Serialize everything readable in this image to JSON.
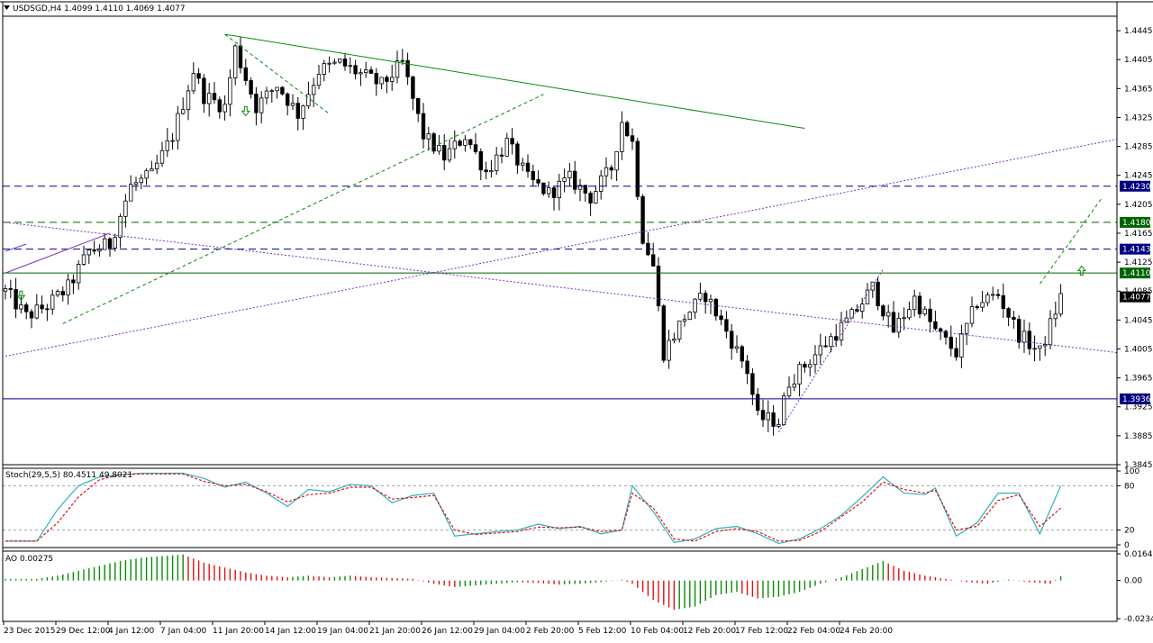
{
  "header": {
    "symbol_line": "USDSGD,H4  1.4099 1.4110 1.4069 1.4077",
    "stoch_label": "Stoch(29,5,5) 80.4511 49.8021",
    "ao_label": "AO 0.00275"
  },
  "colors": {
    "bull_bar": "#000000",
    "bear_bar": "#000000",
    "trend_green": "#0a8a0a",
    "level_blue": "#00008b",
    "level_green": "#006400",
    "channel_purple": "#7b2fbe",
    "stoch_main": "#2fb0c0",
    "stoch_signal": "#e01010",
    "ao_up": "#0a8a0a",
    "ao_down": "#e01010",
    "tag_blue": "#000080",
    "tag_green": "#006400",
    "tag_black": "#000000"
  },
  "chart_data": [
    {
      "type": "candlestick",
      "symbol": "USDSGD",
      "timeframe": "H4",
      "ohlc_current": {
        "open": 1.4099,
        "high": 1.411,
        "low": 1.4069,
        "close": 1.4077
      },
      "ylim": [
        1.3845,
        1.4465
      ],
      "y_ticks": [
        "1.4445",
        "1.4405",
        "1.4365",
        "1.4325",
        "1.4285",
        "1.4245",
        "1.4205",
        "1.4165",
        "1.4125",
        "1.4085",
        "1.4045",
        "1.4005",
        "1.3965",
        "1.3925",
        "1.3885",
        "1.3845"
      ],
      "x_ticks": [
        "23 Dec 2015",
        "29 Dec 12:00",
        "4 Jan 12:00",
        "7 Jan 04:00",
        "11 Jan 20:00",
        "14 Jan 12:00",
        "19 Jan 04:00",
        "21 Jan 20:00",
        "26 Jan 12:00",
        "29 Jan 04:00",
        "2 Feb 20:00",
        "5 Feb 12:00",
        "10 Feb 04:00",
        "12 Feb 20:00",
        "17 Feb 12:00",
        "22 Feb 04:00",
        "24 Feb 20:00"
      ],
      "price_path": [
        [
          0,
          1.4085
        ],
        [
          4,
          1.405
        ],
        [
          8,
          1.4065
        ],
        [
          12,
          1.409
        ],
        [
          16,
          1.414
        ],
        [
          20,
          1.415
        ],
        [
          24,
          1.423
        ],
        [
          28,
          1.4245
        ],
        [
          32,
          1.43
        ],
        [
          36,
          1.439
        ],
        [
          38,
          1.4355
        ],
        [
          42,
          1.434
        ],
        [
          44,
          1.442
        ],
        [
          48,
          1.434
        ],
        [
          52,
          1.437
        ],
        [
          56,
          1.433
        ],
        [
          60,
          1.439
        ],
        [
          64,
          1.44
        ],
        [
          68,
          1.4385
        ],
        [
          72,
          1.437
        ],
        [
          76,
          1.44
        ],
        [
          80,
          1.43
        ],
        [
          84,
          1.427
        ],
        [
          88,
          1.43
        ],
        [
          92,
          1.425
        ],
        [
          96,
          1.429
        ],
        [
          100,
          1.424
        ],
        [
          104,
          1.422
        ],
        [
          108,
          1.424
        ],
        [
          112,
          1.4215
        ],
        [
          116,
          1.4255
        ],
        [
          118,
          1.432
        ],
        [
          120,
          1.429
        ],
        [
          122,
          1.416
        ],
        [
          124,
          1.412
        ],
        [
          126,
          1.4
        ],
        [
          130,
          1.405
        ],
        [
          134,
          1.408
        ],
        [
          138,
          1.403
        ],
        [
          142,
          1.3975
        ],
        [
          144,
          1.391
        ],
        [
          148,
          1.3905
        ],
        [
          150,
          1.396
        ],
        [
          154,
          1.399
        ],
        [
          158,
          1.402
        ],
        [
          162,
          1.405
        ],
        [
          166,
          1.409
        ],
        [
          170,
          1.403
        ],
        [
          174,
          1.4075
        ],
        [
          178,
          1.403
        ],
        [
          182,
          1.4
        ],
        [
          186,
          1.407
        ],
        [
          190,
          1.408
        ],
        [
          194,
          1.4025
        ],
        [
          198,
          1.4
        ],
        [
          202,
          1.4077
        ]
      ],
      "horizontal_levels": [
        {
          "value": 1.423,
          "label": "1.4230",
          "style": "dashed",
          "color": "level_blue"
        },
        {
          "value": 1.418,
          "label": "1.4180",
          "style": "dashed",
          "color": "level_green"
        },
        {
          "value": 1.4143,
          "label": "1.4143",
          "style": "dashed",
          "color": "level_blue"
        },
        {
          "value": 1.411,
          "label": "1.4110",
          "style": "solid",
          "color": "level_green"
        },
        {
          "value": 1.3936,
          "label": "1.3936",
          "style": "solid",
          "color": "level_blue"
        }
      ],
      "current_price_label": "1.4077",
      "trendlines": [
        {
          "from": [
            42,
            1.444
          ],
          "to": [
            153,
            1.431
          ],
          "style": "solid",
          "color": "trend_green"
        },
        {
          "from": [
            42,
            1.444
          ],
          "to": [
            62,
            1.433
          ],
          "style": "dashed",
          "color": "trend_green"
        },
        {
          "from": [
            11,
            1.404
          ],
          "to": [
            103,
            1.4357
          ],
          "style": "dashed",
          "color": "trend_green"
        },
        {
          "from": [
            198,
            1.4095
          ],
          "to": [
            210,
            1.4215
          ],
          "style": "dashed",
          "color": "trend_green"
        },
        {
          "from": [
            0,
            1.3995
          ],
          "to": [
            240,
            1.4295
          ],
          "style": "dotted",
          "color": "channel_purple"
        },
        {
          "from": [
            0,
            1.418
          ],
          "to": [
            240,
            1.4
          ],
          "style": "dotted",
          "color": "channel_purple"
        },
        {
          "from": [
            148,
            1.389
          ],
          "to": [
            168,
            1.4115
          ],
          "style": "dotted",
          "color": "channel_purple"
        },
        {
          "from": [
            0,
            1.411
          ],
          "to": [
            20,
            1.4165
          ],
          "style": "solid",
          "color": "channel_purple"
        },
        {
          "from": [
            0,
            1.414
          ],
          "to": [
            4,
            1.415
          ],
          "style": "solid",
          "color": "channel_purple"
        }
      ],
      "arrows": [
        {
          "x": 3,
          "y": 1.408,
          "direction": "down"
        },
        {
          "x": 46,
          "y": 1.4335,
          "direction": "down"
        },
        {
          "x": 206,
          "y": 1.4112,
          "direction": "up"
        }
      ]
    },
    {
      "type": "line",
      "indicator": "Stochastic",
      "params": "29,5,5",
      "main_value": 80.4511,
      "signal_value": 49.8021,
      "ylim": [
        0,
        100
      ],
      "y_ticks": [
        "100",
        "80",
        "20",
        "0"
      ],
      "levels": [
        80,
        20
      ],
      "series": [
        {
          "role": "main",
          "values": [
            [
              0,
              5
            ],
            [
              6,
              5
            ],
            [
              10,
              48
            ],
            [
              14,
              80
            ],
            [
              18,
              92
            ],
            [
              22,
              95
            ],
            [
              26,
              97
            ],
            [
              30,
              97
            ],
            [
              34,
              97
            ],
            [
              38,
              90
            ],
            [
              42,
              78
            ],
            [
              46,
              85
            ],
            [
              50,
              70
            ],
            [
              54,
              52
            ],
            [
              58,
              75
            ],
            [
              62,
              72
            ],
            [
              66,
              82
            ],
            [
              70,
              80
            ],
            [
              74,
              57
            ],
            [
              78,
              67
            ],
            [
              82,
              70
            ],
            [
              86,
              12
            ],
            [
              90,
              15
            ],
            [
              94,
              18
            ],
            [
              98,
              20
            ],
            [
              102,
              28
            ],
            [
              106,
              22
            ],
            [
              110,
              25
            ],
            [
              114,
              15
            ],
            [
              118,
              20
            ],
            [
              120,
              80
            ],
            [
              124,
              45
            ],
            [
              128,
              3
            ],
            [
              132,
              8
            ],
            [
              136,
              22
            ],
            [
              140,
              25
            ],
            [
              144,
              15
            ],
            [
              148,
              2
            ],
            [
              152,
              8
            ],
            [
              156,
              22
            ],
            [
              160,
              40
            ],
            [
              164,
              65
            ],
            [
              168,
              92
            ],
            [
              172,
              70
            ],
            [
              176,
              68
            ],
            [
              178,
              77
            ],
            [
              182,
              12
            ],
            [
              186,
              30
            ],
            [
              190,
              70
            ],
            [
              194,
              70
            ],
            [
              198,
              15
            ],
            [
              202,
              80
            ]
          ]
        },
        {
          "role": "signal",
          "values": [
            [
              0,
              5
            ],
            [
              6,
              5
            ],
            [
              10,
              30
            ],
            [
              14,
              65
            ],
            [
              18,
              88
            ],
            [
              22,
              95
            ],
            [
              26,
              96
            ],
            [
              30,
              96
            ],
            [
              34,
              96
            ],
            [
              38,
              86
            ],
            [
              42,
              80
            ],
            [
              46,
              82
            ],
            [
              50,
              72
            ],
            [
              54,
              58
            ],
            [
              58,
              68
            ],
            [
              62,
              70
            ],
            [
              66,
              78
            ],
            [
              70,
              78
            ],
            [
              74,
              62
            ],
            [
              78,
              64
            ],
            [
              82,
              67
            ],
            [
              86,
              20
            ],
            [
              90,
              14
            ],
            [
              94,
              16
            ],
            [
              98,
              18
            ],
            [
              102,
              24
            ],
            [
              106,
              23
            ],
            [
              110,
              24
            ],
            [
              114,
              18
            ],
            [
              118,
              20
            ],
            [
              120,
              70
            ],
            [
              124,
              50
            ],
            [
              128,
              8
            ],
            [
              132,
              5
            ],
            [
              136,
              18
            ],
            [
              140,
              22
            ],
            [
              144,
              18
            ],
            [
              148,
              5
            ],
            [
              152,
              6
            ],
            [
              156,
              18
            ],
            [
              160,
              38
            ],
            [
              164,
              58
            ],
            [
              168,
              85
            ],
            [
              172,
              75
            ],
            [
              176,
              70
            ],
            [
              178,
              74
            ],
            [
              182,
              20
            ],
            [
              186,
              25
            ],
            [
              190,
              60
            ],
            [
              194,
              68
            ],
            [
              198,
              25
            ],
            [
              202,
              49.8
            ]
          ]
        }
      ]
    },
    {
      "type": "bar",
      "indicator": "Awesome Oscillator",
      "current_value": 0.00275,
      "ylim": [
        -0.02345,
        0.0164
      ],
      "y_ticks": [
        "0.0164",
        "0.00",
        "-0.02345"
      ],
      "values": [
        [
          0,
          0.001
        ],
        [
          6,
          0.001
        ],
        [
          10,
          0.003
        ],
        [
          14,
          0.006
        ],
        [
          18,
          0.009
        ],
        [
          22,
          0.012
        ],
        [
          26,
          0.014
        ],
        [
          30,
          0.015
        ],
        [
          34,
          0.016
        ],
        [
          38,
          0.011
        ],
        [
          42,
          0.008
        ],
        [
          46,
          0.005
        ],
        [
          50,
          0.003
        ],
        [
          54,
          0.002
        ],
        [
          58,
          0.003
        ],
        [
          62,
          0.002
        ],
        [
          66,
          0.003
        ],
        [
          70,
          0.002
        ],
        [
          74,
          0.0015
        ],
        [
          78,
          0.001
        ],
        [
          82,
          -0.002
        ],
        [
          86,
          -0.004
        ],
        [
          90,
          -0.003
        ],
        [
          94,
          -0.002
        ],
        [
          98,
          -0.001
        ],
        [
          102,
          -0.0015
        ],
        [
          106,
          -0.0025
        ],
        [
          110,
          -0.002
        ],
        [
          114,
          -0.001
        ],
        [
          118,
          0.0005
        ],
        [
          120,
          -0.002
        ],
        [
          124,
          -0.012
        ],
        [
          128,
          -0.018
        ],
        [
          132,
          -0.016
        ],
        [
          136,
          -0.009
        ],
        [
          140,
          -0.007
        ],
        [
          144,
          -0.011
        ],
        [
          148,
          -0.01
        ],
        [
          152,
          -0.007
        ],
        [
          156,
          -0.002
        ],
        [
          160,
          0.002
        ],
        [
          164,
          0.007
        ],
        [
          168,
          0.012
        ],
        [
          172,
          0.006
        ],
        [
          176,
          0.003
        ],
        [
          180,
          0.001
        ],
        [
          184,
          -0.001
        ],
        [
          188,
          -0.002
        ],
        [
          192,
          0.0005
        ],
        [
          196,
          -0.001
        ],
        [
          200,
          -0.002
        ],
        [
          202,
          0.00275
        ]
      ]
    }
  ]
}
